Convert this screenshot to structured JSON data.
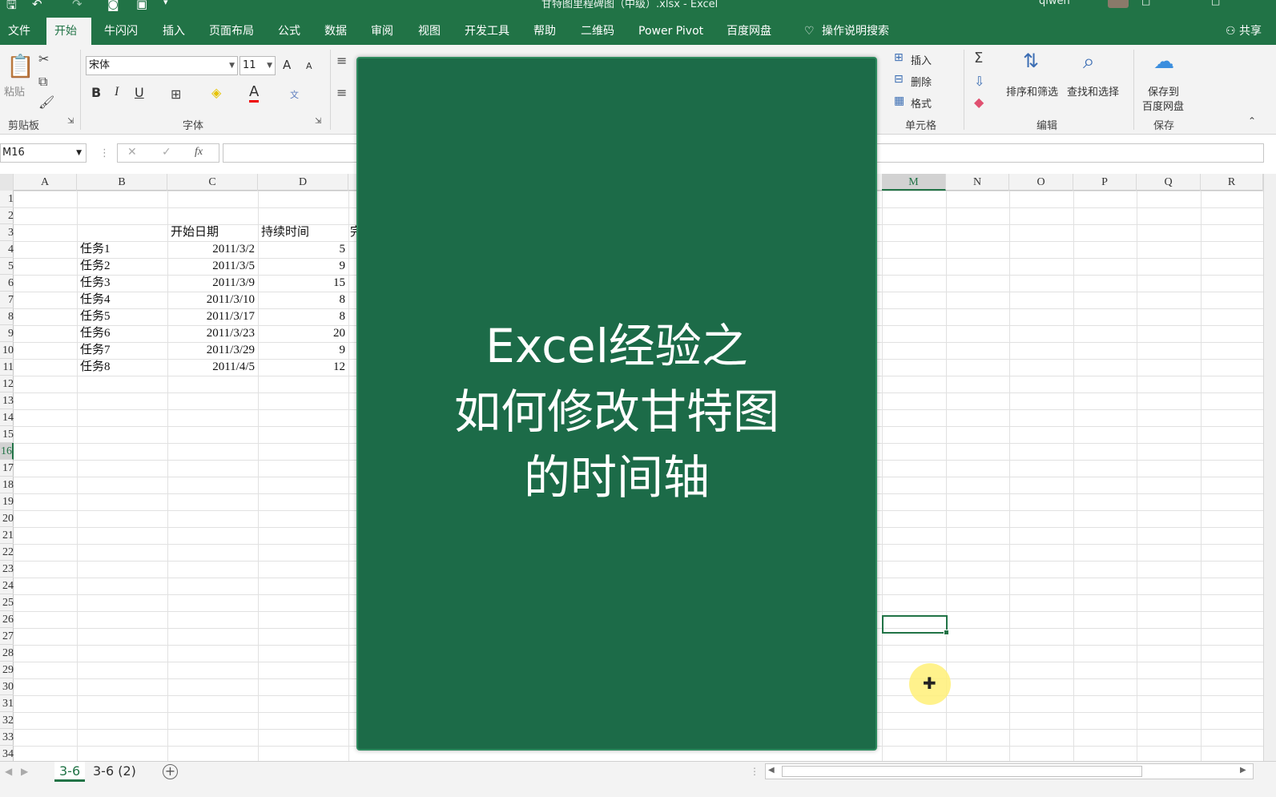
{
  "titlebar": {
    "window_title": "甘特图里程碑图（中级）.xlsx - Excel",
    "user": "qiwen"
  },
  "tabs": [
    {
      "label": "文件"
    },
    {
      "label": "开始"
    },
    {
      "label": "牛闪闪"
    },
    {
      "label": "插入"
    },
    {
      "label": "页面布局"
    },
    {
      "label": "公式"
    },
    {
      "label": "数据"
    },
    {
      "label": "审阅"
    },
    {
      "label": "视图"
    },
    {
      "label": "开发工具"
    },
    {
      "label": "帮助"
    },
    {
      "label": "二维码"
    },
    {
      "label": "Power Pivot"
    },
    {
      "label": "百度网盘"
    },
    {
      "label": "操作说明搜索"
    }
  ],
  "share_label": "共享",
  "ribbon": {
    "clipboard": {
      "paste": "粘贴",
      "label": "剪贴板"
    },
    "font": {
      "family": "宋体",
      "size": "11",
      "label": "字体",
      "bold": "B",
      "italic": "I",
      "underline": "U",
      "grow": "A",
      "shrink": "A",
      "color_a": "A",
      "wen": "文"
    },
    "cells": {
      "insert": "插入",
      "delete": "删除",
      "format": "格式",
      "label": "单元格"
    },
    "editing": {
      "sort_filter": "排序和筛选",
      "find_select": "查找和选择",
      "label": "编辑"
    },
    "save": {
      "save_to": "保存到",
      "baidu": "百度网盘",
      "label": "保存"
    }
  },
  "formula_bar": {
    "name_box": "M16",
    "fx": "fx",
    "cancel": "✕",
    "confirm": "✓"
  },
  "columns": [
    "A",
    "B",
    "C",
    "D",
    "M",
    "N",
    "O",
    "P",
    "Q",
    "R"
  ],
  "rows": [
    "1",
    "2",
    "3",
    "4",
    "5",
    "6",
    "7",
    "8",
    "9",
    "10",
    "11",
    "12",
    "13",
    "14",
    "15",
    "16",
    "17",
    "18",
    "19",
    "20",
    "21",
    "22",
    "23",
    "24",
    "25",
    "26",
    "27",
    "28",
    "29",
    "30",
    "31",
    "32",
    "33",
    "34"
  ],
  "table": {
    "headers": {
      "start": "开始日期",
      "duration": "持续时间",
      "extra": "完"
    },
    "tasks": [
      {
        "name": "任务1",
        "start": "2011/3/2",
        "duration": "5"
      },
      {
        "name": "任务2",
        "start": "2011/3/5",
        "duration": "9"
      },
      {
        "name": "任务3",
        "start": "2011/3/9",
        "duration": "15"
      },
      {
        "name": "任务4",
        "start": "2011/3/10",
        "duration": "8"
      },
      {
        "name": "任务5",
        "start": "2011/3/17",
        "duration": "8"
      },
      {
        "name": "任务6",
        "start": "2011/3/23",
        "duration": "20"
      },
      {
        "name": "任务7",
        "start": "2011/3/29",
        "duration": "9"
      },
      {
        "name": "任务8",
        "start": "2011/4/5",
        "duration": "12"
      }
    ]
  },
  "overlay": {
    "line1": "Excel经验之",
    "line2": "如何修改甘特图",
    "line3": "的时间轴",
    "bg_color": "#1c6b48"
  },
  "sheets": [
    {
      "label": "3-6"
    },
    {
      "label": "3-6 (2)"
    }
  ],
  "accent_color": "#217346"
}
